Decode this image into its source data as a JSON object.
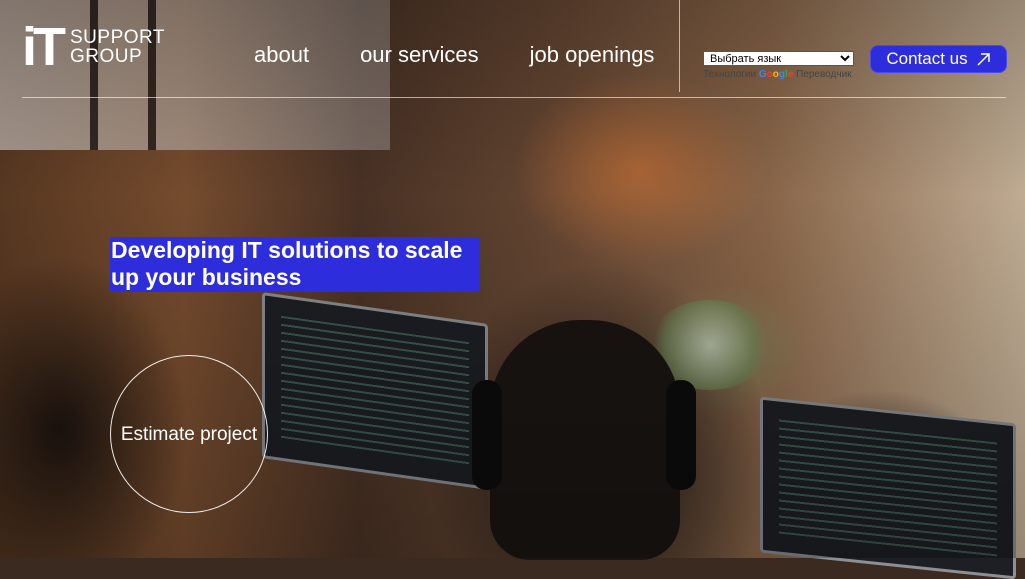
{
  "logo": {
    "mark": "iT",
    "line1": "SUPPORT",
    "line2": "GROUP"
  },
  "nav": {
    "items": [
      {
        "label": "about"
      },
      {
        "label": "our services"
      },
      {
        "label": "job openings"
      }
    ]
  },
  "translate": {
    "select_value": "Выбрать язык",
    "powered_prefix": "Технологии",
    "powered_brand": [
      "G",
      "o",
      "o",
      "g",
      "l",
      "e"
    ],
    "powered_suffix": "Переводчик"
  },
  "contact": {
    "label": "Contact us",
    "icon": "arrow-up-right-icon"
  },
  "hero": {
    "headline": "Developing IT solutions to scale up your business",
    "estimate_label": "Estimate project"
  },
  "colors": {
    "accent": "#2e2ddc",
    "text_on_dark": "#ffffff"
  }
}
